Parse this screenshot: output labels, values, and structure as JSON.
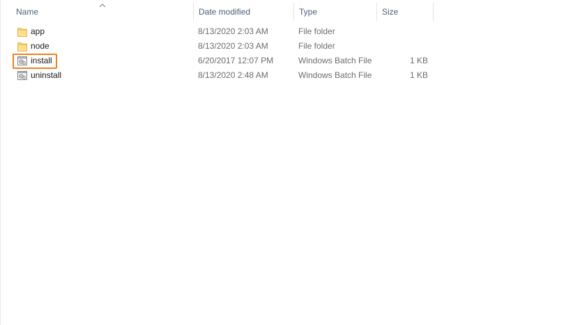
{
  "columns": {
    "name": "Name",
    "date_modified": "Date modified",
    "type": "Type",
    "size": "Size"
  },
  "sort": {
    "column": "name",
    "direction": "ascending",
    "icon": "chevron-up-icon"
  },
  "files": [
    {
      "name": "app",
      "date": "8/13/2020 2:03 AM",
      "type": "File folder",
      "size": "",
      "icon": "folder-icon"
    },
    {
      "name": "node",
      "date": "8/13/2020 2:03 AM",
      "type": "File folder",
      "size": "",
      "icon": "folder-icon"
    },
    {
      "name": "install",
      "date": "6/20/2017 12:07 PM",
      "type": "Windows Batch File",
      "size": "1 KB",
      "icon": "batch-file-icon",
      "highlighted": true
    },
    {
      "name": "uninstall",
      "date": "8/13/2020 2:48 AM",
      "type": "Windows Batch File",
      "size": "1 KB",
      "icon": "batch-file-icon"
    }
  ],
  "colors": {
    "highlight_border": "#f08020",
    "header_text": "#4c607a",
    "folder_fill": "#ffd766"
  }
}
